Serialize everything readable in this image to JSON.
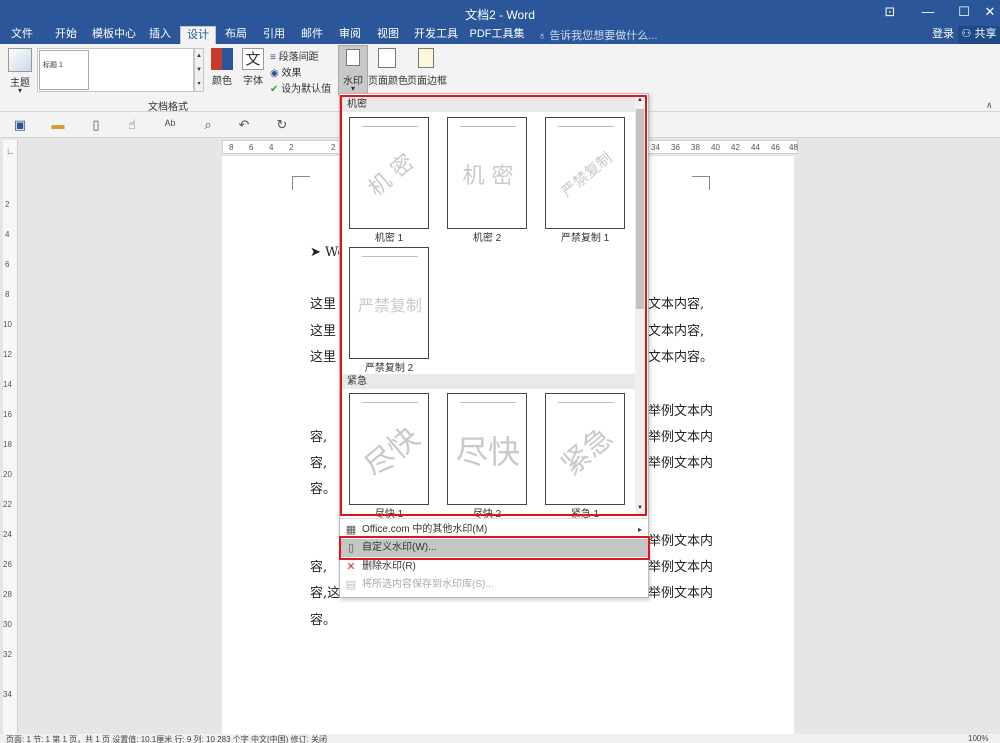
{
  "titlebar": {
    "title": "文档2 - Word",
    "ctrl_ribbon": "⊡",
    "ctrl_min": "—",
    "ctrl_max": "☐",
    "ctrl_close": "✕"
  },
  "tabs": [
    "文件",
    "开始",
    "模板中心",
    "插入",
    "设计",
    "布局",
    "引用",
    "邮件",
    "审阅",
    "视图",
    "开发工具",
    "PDF工具集"
  ],
  "active_tab": "设计",
  "tell_me": "告诉我您想要做什么...",
  "login": "登录",
  "share": "共享",
  "ribbon": {
    "theme": "主题",
    "style_label": "标题 1",
    "colors": "颜色",
    "fonts": "字体",
    "font_glyph": "文",
    "para_spacing": "段落间距",
    "effects": "效果",
    "set_default": "设为默认值",
    "group_label": "文档格式",
    "watermark": "水印",
    "page_color": "页面颜色",
    "page_border": "页面边框"
  },
  "ruler_top": [
    "8",
    "6",
    "4",
    "2",
    "2",
    "34",
    "36",
    "38",
    "40",
    "42",
    "44",
    "46",
    "48"
  ],
  "ruler_left": [
    "2",
    "4",
    "6",
    "8",
    "10",
    "12",
    "14",
    "16",
    "18",
    "20",
    "22",
    "24",
    "26",
    "28",
    "30",
    "32",
    "34"
  ],
  "document": {
    "bullet_text": "Wo",
    "lines": [
      {
        "left": "这里",
        "right": "文本内容,"
      },
      {
        "left": "这里",
        "right": "文本内容,"
      },
      {
        "left": "这里",
        "right": "文本内容。"
      },
      {
        "left": "",
        "right": "举例文本内"
      },
      {
        "left": "容,",
        "right": "举例文本内"
      },
      {
        "left": "容,",
        "right": "举例文本内"
      },
      {
        "left": "容。",
        "right": ""
      },
      {
        "left": "",
        "right": "举例文本内"
      },
      {
        "left": "容,",
        "right": "举例文本内"
      },
      {
        "left": "容,这",
        "right": "举例文本内"
      },
      {
        "left": "容。",
        "right": ""
      }
    ]
  },
  "watermark_menu": {
    "section1": "机密",
    "section2": "紧急",
    "items": [
      {
        "label": "机密 1",
        "text": "机 密"
      },
      {
        "label": "机密 2",
        "text": "机 密"
      },
      {
        "label": "严禁复制 1",
        "text": "严禁复制"
      },
      {
        "label": "严禁复制 2",
        "text": "严禁复制"
      },
      {
        "label": "尽快 1",
        "text": "尽快"
      },
      {
        "label": "尽快 2",
        "text": "尽快"
      },
      {
        "label": "紧急 1",
        "text": "紧急"
      }
    ],
    "more": "Office.com 中的其他水印(M)",
    "custom": "自定义水印(W)...",
    "remove": "删除水印(R)",
    "save": "将所选内容保存到水印库(S)..."
  },
  "status": "页面: 1   节: 1   第 1 页，共 1 页   设置值: 10.1厘米   行: 9   列: 10   283 个字   中文(中国)   修订: 关闭",
  "zoom": "100%",
  "colors": {
    "accent": "#2b579a",
    "highlight": "#e0141e"
  }
}
